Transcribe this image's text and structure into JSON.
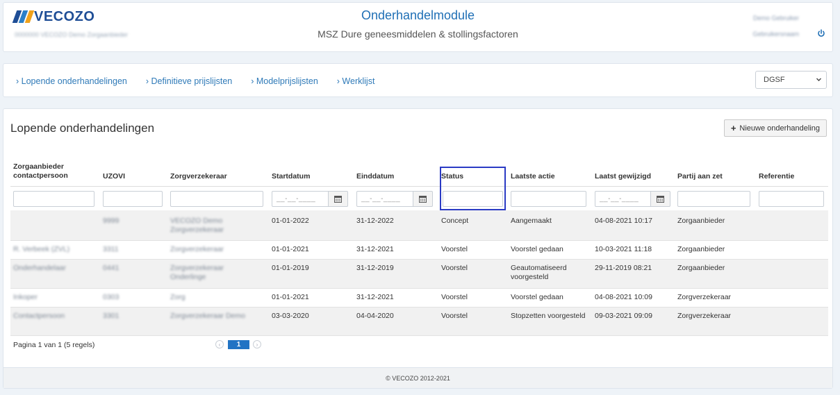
{
  "header": {
    "logo_text": "VECOZO",
    "logo_colors": [
      "#1f4e96",
      "#2a7fc8",
      "#f0a21c"
    ],
    "org_line": "0000000 VECOZO Demo Zorgaanbieder",
    "app_title": "Onderhandelmodule",
    "app_subtitle": "MSZ Dure geneesmiddelen & stollingsfactoren",
    "user_name": "Demo Gebruiker",
    "user_detail": "Gebruikersnaam"
  },
  "nav": {
    "links": [
      "› Lopende onderhandelingen",
      "› Definitieve prijslijsten",
      "› Modelprijslijsten",
      "› Werklijst"
    ],
    "select_value": "DGSF"
  },
  "main": {
    "title": "Lopende onderhandelingen",
    "new_button_label": "Nieuwe onderhandeling",
    "columns": [
      "Zorgaanbieder contactpersoon",
      "UZOVI",
      "Zorgverzekeraar",
      "Startdatum",
      "Einddatum",
      "Status",
      "Laatste actie",
      "Laatst gewijzigd",
      "Partij aan zet",
      "Referentie"
    ],
    "date_placeholder": "__-__-____",
    "rows": [
      {
        "contact": "",
        "uzovi": "9999",
        "verzekeraar": "VECOZO Demo Zorgverzekeraar",
        "start": "01-01-2022",
        "end": "31-12-2022",
        "status": "Concept",
        "actie": "Aangemaakt",
        "gewijzigd": "04-08-2021 10:17",
        "partij": "Zorgaanbieder",
        "ref": ""
      },
      {
        "contact": "R. Verbeek (ZVL)",
        "uzovi": "3311",
        "verzekeraar": "Zorgverzekeraar",
        "start": "01-01-2021",
        "end": "31-12-2021",
        "status": "Voorstel",
        "actie": "Voorstel gedaan",
        "gewijzigd": "10-03-2021 11:18",
        "partij": "Zorgaanbieder",
        "ref": ""
      },
      {
        "contact": "Onderhandelaar",
        "uzovi": "0441",
        "verzekeraar": "Zorgverzekeraar Onderlinge",
        "start": "01-01-2019",
        "end": "31-12-2019",
        "status": "Voorstel",
        "actie": "Geautomatiseerd voorgesteld",
        "gewijzigd": "29-11-2019 08:21",
        "partij": "Zorgaanbieder",
        "ref": ""
      },
      {
        "contact": "Inkoper",
        "uzovi": "0303",
        "verzekeraar": "Zorg",
        "start": "01-01-2021",
        "end": "31-12-2021",
        "status": "Voorstel",
        "actie": "Voorstel gedaan",
        "gewijzigd": "04-08-2021 10:09",
        "partij": "Zorgverzekeraar",
        "ref": ""
      },
      {
        "contact": "Contactpersoon",
        "uzovi": "3301",
        "verzekeraar": "Zorgverzekeraar Demo",
        "start": "03-03-2020",
        "end": "04-04-2020",
        "status": "Voorstel",
        "actie": "Stopzetten voorgesteld",
        "gewijzigd": "09-03-2021 09:09",
        "partij": "Zorgverzekeraar",
        "ref": ""
      }
    ],
    "pager_text": "Pagina 1 van 1 (5 regels)",
    "current_page": "1",
    "pager_prev": "‹",
    "pager_next": "›"
  },
  "footer": {
    "copyright": "© VECOZO 2012-2021"
  },
  "colors": {
    "accent": "#1f6fb5",
    "link": "#2f7ab8",
    "focus_outline": "#2a3ac4",
    "page_button": "#2173c4"
  },
  "icons": [
    "power-icon",
    "chevron-down-icon",
    "plus-icon",
    "calendar-icon",
    "chevron-left-icon",
    "chevron-right-icon"
  ]
}
